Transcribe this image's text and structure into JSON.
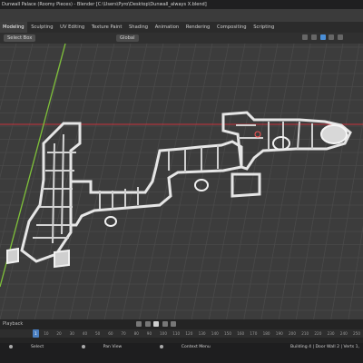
{
  "app": {
    "title": "Dunwall Palace (Roomy Pieces) - Blender [C:\\Users\\Pyro\\Desktop\\Dunwall_always X.blend]"
  },
  "workspaces": {
    "tabs": [
      "Modeling",
      "Sculpting",
      "UV Editing",
      "Texture Paint",
      "Shading",
      "Animation",
      "Rendering",
      "Compositing",
      "Scripting"
    ],
    "active_index": 0
  },
  "header": {
    "select_mode": "Select Box",
    "orientation": "Global"
  },
  "viewport": {
    "x_axis_color": "#c8323c",
    "y_axis_color": "#7fc13a",
    "grid_color": "#4a4a4a",
    "background": "#3c3c3c",
    "model_color": "#e6e6e6"
  },
  "timeline": {
    "playback_label": "Playback",
    "current_frame": "1",
    "frame_ticks": [
      "0",
      "10",
      "20",
      "30",
      "40",
      "50",
      "60",
      "70",
      "80",
      "90",
      "100",
      "110",
      "120",
      "130",
      "140",
      "150",
      "160",
      "170",
      "180",
      "190",
      "200",
      "210",
      "220",
      "230",
      "240",
      "250"
    ]
  },
  "statusbar": {
    "hints": [
      "Select",
      "Pan View",
      "Context Menu"
    ],
    "scene_stats": "Building 4 | Door Wall 2 | Verts 1,"
  }
}
